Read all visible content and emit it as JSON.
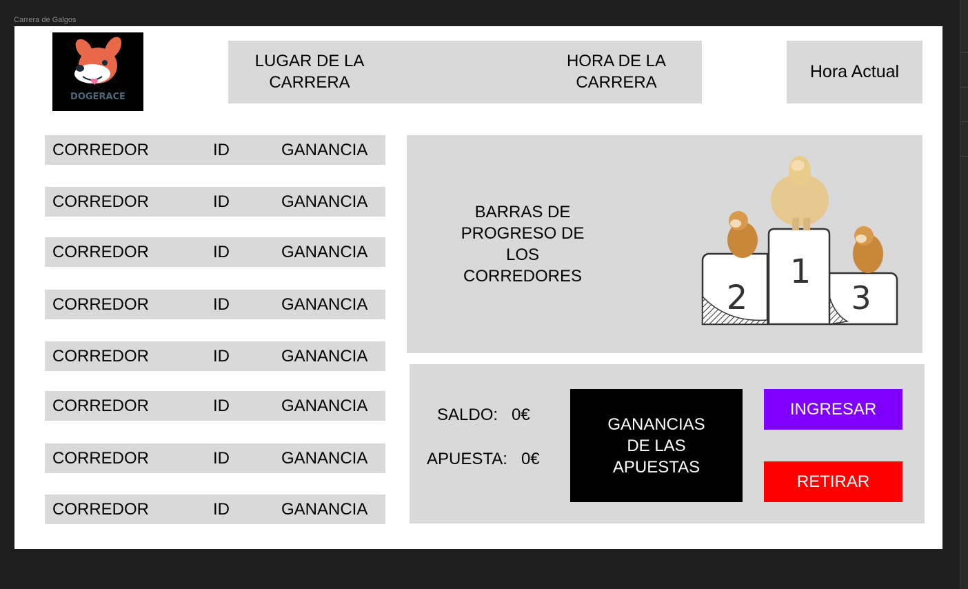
{
  "frame": {
    "title": "Carrera de Galgos"
  },
  "logo": {
    "text": "DOGERACE"
  },
  "header": {
    "lugar": "LUGAR DE LA\nCARRERA",
    "hora_carrera": "HORA DE LA\nCARRERA",
    "hora_actual": "Hora Actual"
  },
  "table": {
    "rows": [
      {
        "corredor": "CORREDOR",
        "id": "ID",
        "ganancia": "GANANCIA"
      },
      {
        "corredor": "CORREDOR",
        "id": "ID",
        "ganancia": "GANANCIA"
      },
      {
        "corredor": "CORREDOR",
        "id": "ID",
        "ganancia": "GANANCIA"
      },
      {
        "corredor": "CORREDOR",
        "id": "ID",
        "ganancia": "GANANCIA"
      },
      {
        "corredor": "CORREDOR",
        "id": "ID",
        "ganancia": "GANANCIA"
      },
      {
        "corredor": "CORREDOR",
        "id": "ID",
        "ganancia": "GANANCIA"
      },
      {
        "corredor": "CORREDOR",
        "id": "ID",
        "ganancia": "GANANCIA"
      },
      {
        "corredor": "CORREDOR",
        "id": "ID",
        "ganancia": "GANANCIA"
      }
    ]
  },
  "progress": {
    "label": "BARRAS DE\nPROGRESO DE\nLOS\nCORREDORES",
    "podium": [
      "1",
      "2",
      "3"
    ]
  },
  "wallet": {
    "saldo_label": "SALDO:",
    "saldo_value": "0€",
    "apuesta_label": "APUESTA:",
    "apuesta_value": "0€",
    "ganancias": "GANANCIAS\nDE LAS\nAPUESTAS",
    "ingresar": "INGRESAR",
    "retirar": "RETIRAR"
  },
  "colors": {
    "panel": "#d9d9d9",
    "ingresar": "#7f00ff",
    "retirar": "#ff0000"
  }
}
